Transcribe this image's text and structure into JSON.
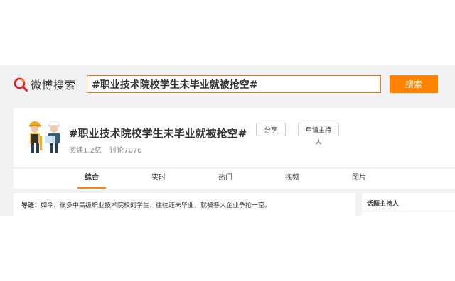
{
  "header": {
    "logo_text": "微博搜索",
    "search_value": "#职业技术院校学生未毕业就被抢空#",
    "search_button": "搜索"
  },
  "topic": {
    "title": "#职业技术院校学生未毕业就被抢空#",
    "share_label": "分享",
    "host_label": "申请主持人",
    "reads": "阅读1.2亿",
    "discussions": "讨论7076"
  },
  "tabs": [
    {
      "label": "综合",
      "active": true
    },
    {
      "label": "实时",
      "active": false
    },
    {
      "label": "热门",
      "active": false
    },
    {
      "label": "视频",
      "active": false
    },
    {
      "label": "图片",
      "active": false
    }
  ],
  "lead": {
    "label": "导语",
    "text": "：如今，很多中高级职业技术院校的学生，往往还未毕业，就被各大企业争抢一空。"
  },
  "sidebar": {
    "title": "话题主持人"
  },
  "colors": {
    "accent": "#ff8200",
    "background": "#f2f2f5"
  }
}
